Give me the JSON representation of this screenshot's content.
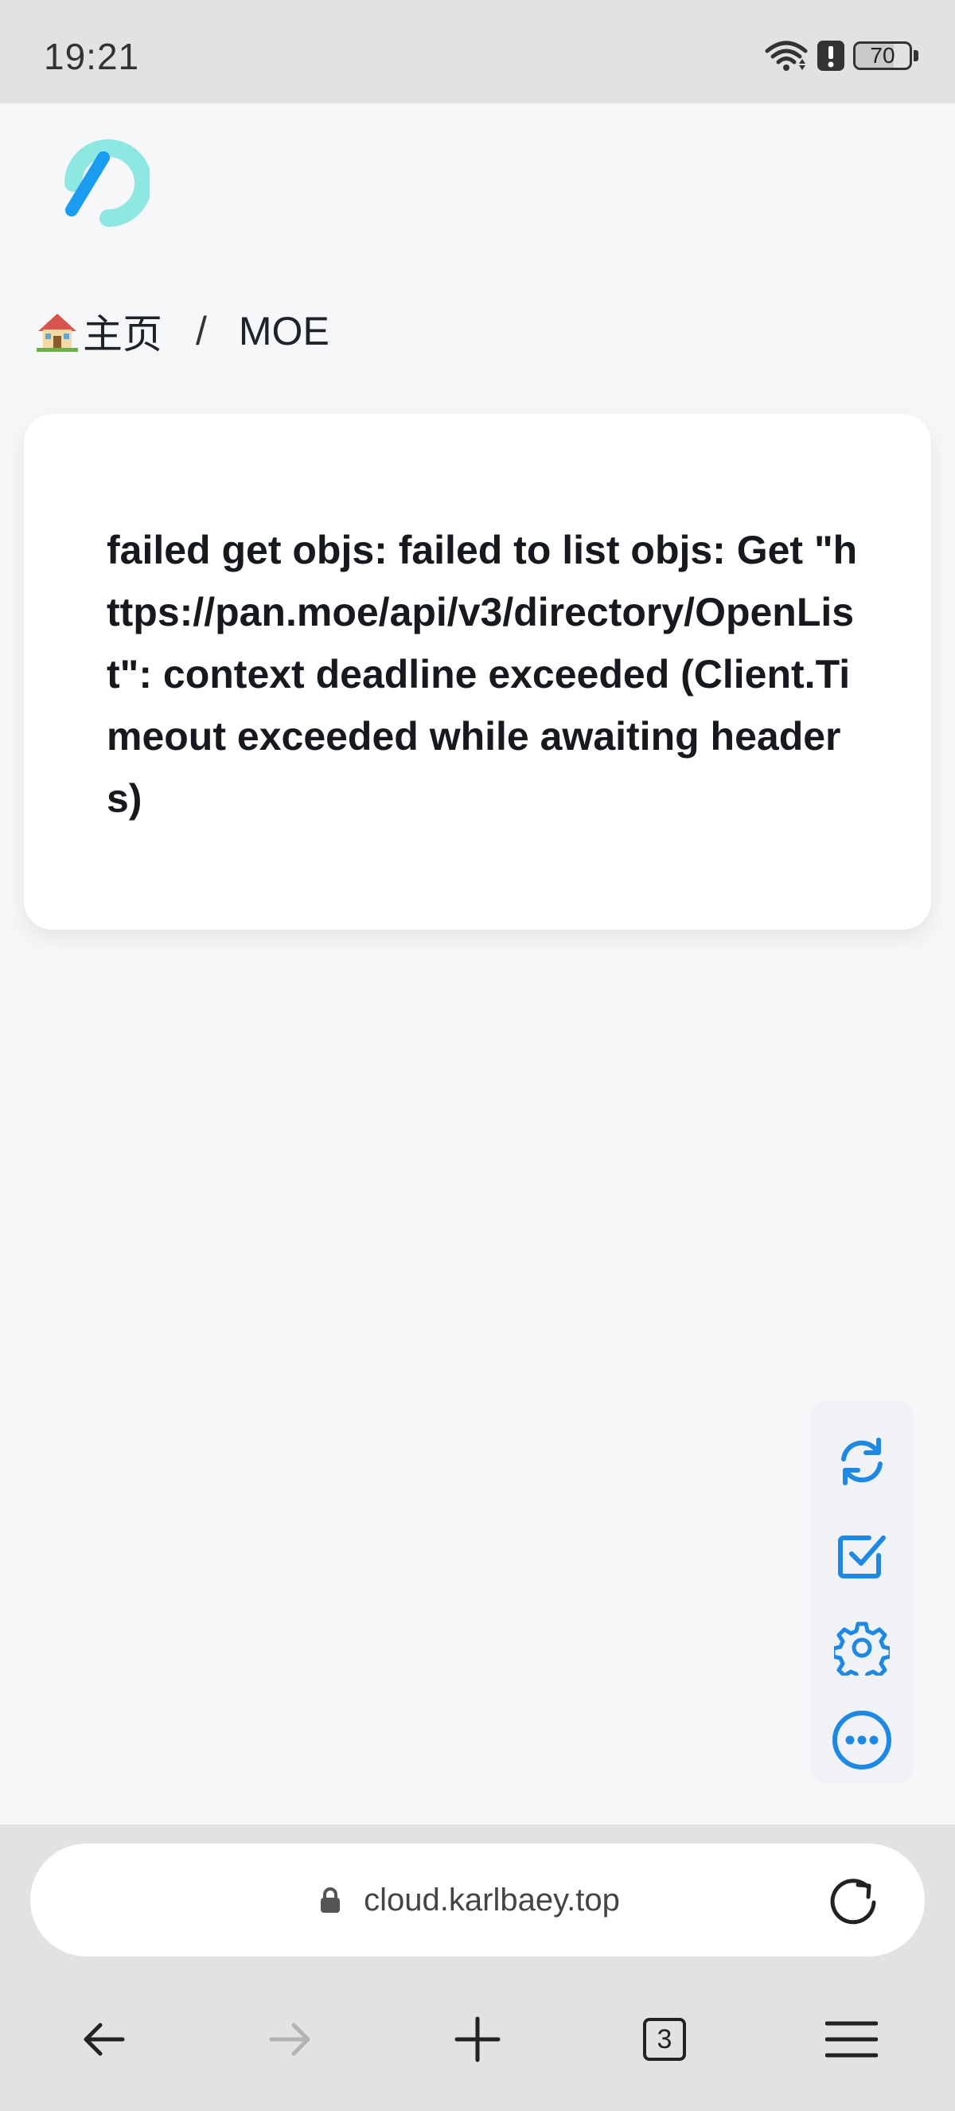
{
  "status_bar": {
    "time": "19:21",
    "battery_level": "70",
    "battery_fraction": 0.7,
    "icons": [
      "wifi-icon",
      "alert-notification-icon",
      "battery-icon"
    ]
  },
  "app": {
    "logo": "alist-logo",
    "breadcrumb": {
      "home_emoji": "house-emoji-icon",
      "home_label": "主页",
      "separator": "/",
      "current": "MOE"
    },
    "error_message": "failed get objs: failed to list objs: Get \"https://pan.moe/api/v3/directory/OpenList\": context deadline exceeded (Client.Timeout exceeded while awaiting headers)",
    "floating_toolbar": [
      "refresh-icon",
      "checkbox-icon",
      "gear-icon",
      "more-icon"
    ],
    "accent_color": "#1e88e5"
  },
  "browser": {
    "address": "cloud.karlbaey.top",
    "tab_count": "3",
    "nav": [
      "back-arrow-icon",
      "forward-arrow-icon",
      "plus-icon",
      "tabs-icon",
      "menu-icon"
    ]
  }
}
